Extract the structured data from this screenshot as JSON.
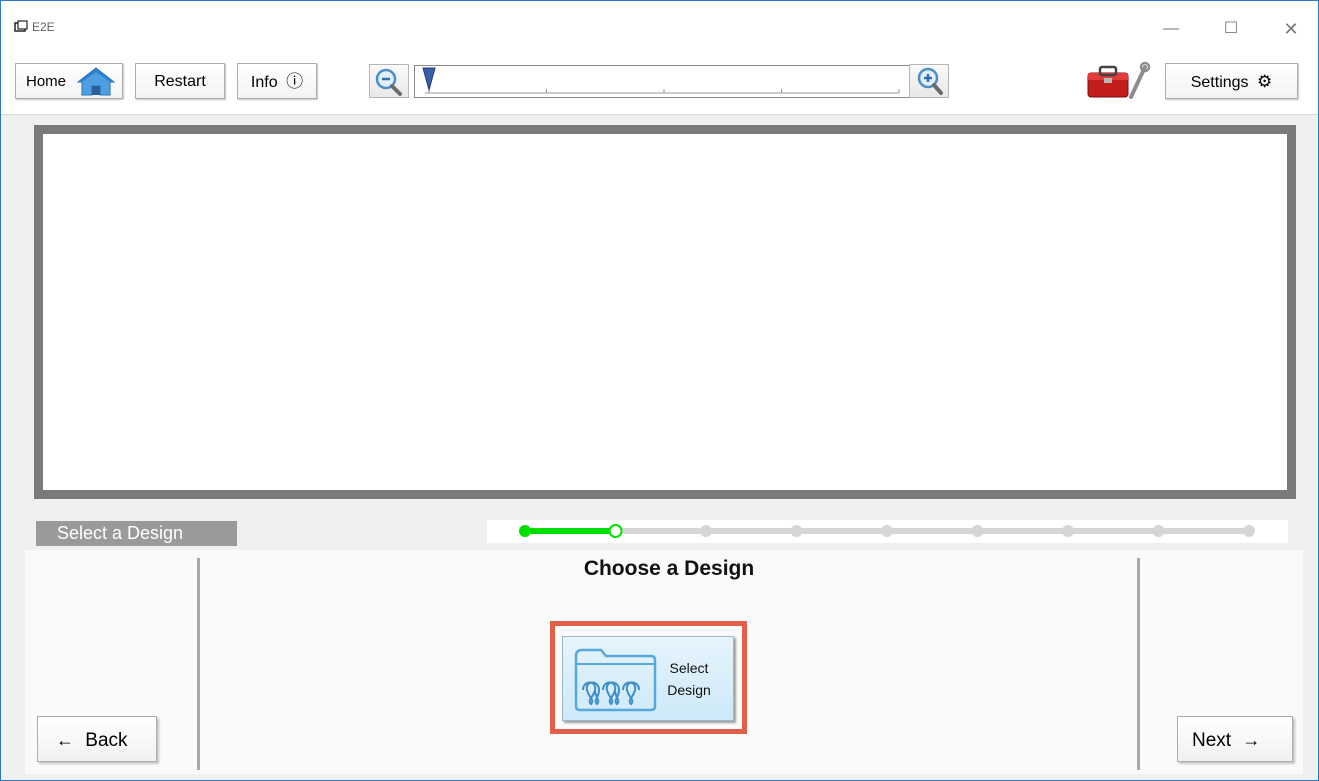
{
  "window": {
    "title": "E2E",
    "controls": {
      "minimize": "—",
      "maximize": "☐",
      "close": "✕"
    }
  },
  "toolbar": {
    "home_label": "Home",
    "restart_label": "Restart",
    "info_label": "Info",
    "info_icon": "ⓘ",
    "settings_label": "Settings",
    "settings_icon": "⚙"
  },
  "zoom": {
    "level_fraction": 0.0,
    "tick_count": 5
  },
  "step": {
    "label": "Select a Design",
    "progress": {
      "total_steps": 9,
      "current_step": 2
    }
  },
  "main": {
    "heading": "Choose a Design",
    "select_design_label": "Select\nDesign"
  },
  "navigation": {
    "back_label": "Back",
    "back_arrow": "←",
    "next_label": "Next",
    "next_arrow": "→"
  },
  "colors": {
    "progress_active": "#00e000",
    "progress_inactive": "#d6d6d6",
    "highlight": "#e0604b",
    "step_label_bg": "#9a9a9a",
    "window_border": "#2b78c8"
  }
}
